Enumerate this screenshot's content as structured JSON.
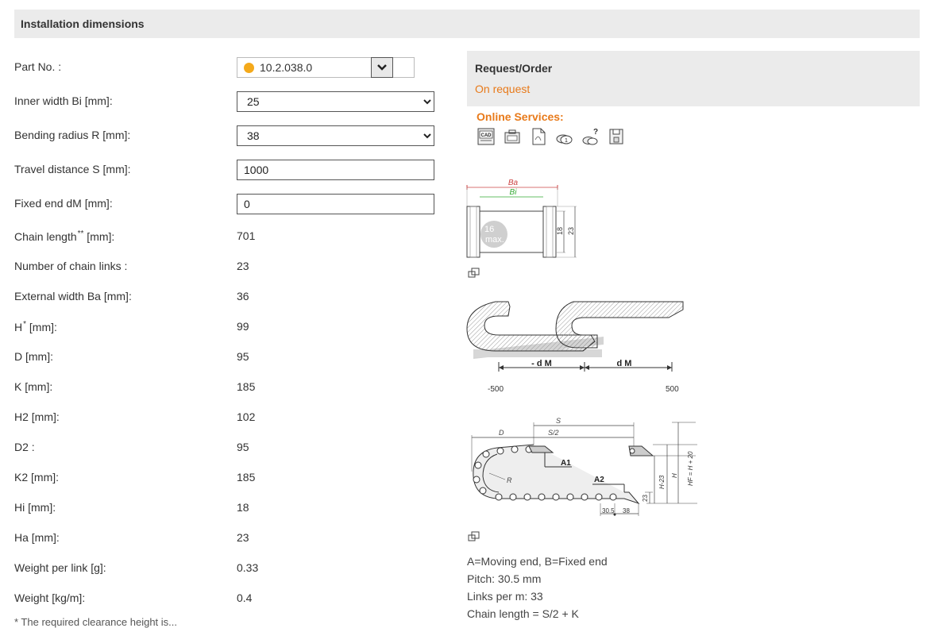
{
  "section": {
    "title": "Installation dimensions"
  },
  "form": {
    "part_no_label": "Part No. :",
    "part_no_value": "10.2.038.0",
    "inner_width_label": "Inner width Bi [mm]:",
    "inner_width_value": "25",
    "bending_radius_label": "Bending radius R [mm]:",
    "bending_radius_value": "38",
    "travel_distance_label": "Travel distance S [mm]:",
    "travel_distance_value": "1000",
    "fixed_end_label": "Fixed end dM [mm]:",
    "fixed_end_value": "0"
  },
  "results": [
    {
      "label": "Chain length",
      "sup": "**",
      "unit": " [mm]:",
      "value": "701"
    },
    {
      "label": "Number of chain links :",
      "sup": "",
      "unit": "",
      "value": "23"
    },
    {
      "label": "External width Ba [mm]:",
      "sup": "",
      "unit": "",
      "value": "36"
    },
    {
      "label": "H",
      "sup": "*",
      "unit": " [mm]:",
      "value": "99"
    },
    {
      "label": "D [mm]:",
      "sup": "",
      "unit": "",
      "value": "95"
    },
    {
      "label": "K [mm]:",
      "sup": "",
      "unit": "",
      "value": "185"
    },
    {
      "label": "H2 [mm]:",
      "sup": "",
      "unit": "",
      "value": "102"
    },
    {
      "label": "D2 :",
      "sup": "",
      "unit": "",
      "value": "95"
    },
    {
      "label": "K2 [mm]:",
      "sup": "",
      "unit": "",
      "value": "185"
    },
    {
      "label": "Hi [mm]:",
      "sup": "",
      "unit": "",
      "value": "18"
    },
    {
      "label": "Ha [mm]:",
      "sup": "",
      "unit": "",
      "value": "23"
    },
    {
      "label": "Weight per link [g]:",
      "sup": "",
      "unit": "",
      "value": "0.33"
    },
    {
      "label": "Weight [kg/m]:",
      "sup": "",
      "unit": "",
      "value": "0.4"
    }
  ],
  "request": {
    "title": "Request/Order",
    "value": "On request",
    "online_services": "Online Services:",
    "icons": [
      "cad-icon",
      "configurator-icon",
      "pdf-icon",
      "quantity-icon",
      "help-icon",
      "save-icon"
    ]
  },
  "diagram1": {
    "ba": "Ba",
    "bi": "Bi",
    "hi": "18",
    "ha": "23",
    "max_value": "16",
    "max_label": "max."
  },
  "diagram2": {
    "neg_dm": "- d M",
    "dm": "d M",
    "min": "-500",
    "max": "500"
  },
  "diagram3": {
    "s": "S",
    "s2": "S/2",
    "d": "D",
    "a1": "A1",
    "a2": "A2",
    "r": "R",
    "h23": "H-23",
    "h": "H",
    "hf": "HF = H + 20",
    "dim23": "23",
    "pitch_dim": "30.5",
    "dim38": "38"
  },
  "notes": {
    "line1": "A=Moving end, B=Fixed end",
    "line2": "Pitch: 30.5 mm",
    "line3": "Links per m: 33",
    "line4": "Chain length = S/2 + K"
  },
  "footnote": "* The required clearance height is..."
}
